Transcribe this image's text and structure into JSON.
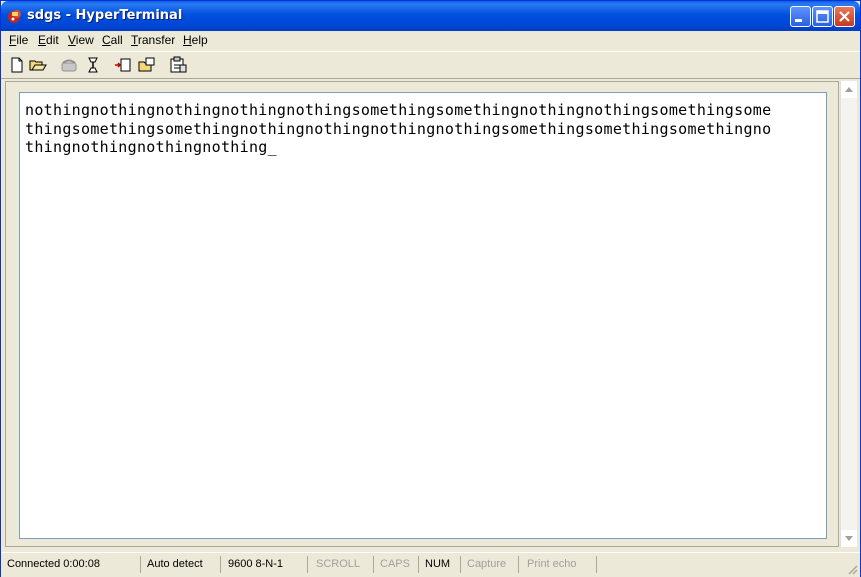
{
  "window": {
    "title": "sdgs - HyperTerminal"
  },
  "menu": [
    "File",
    "Edit",
    "View",
    "Call",
    "Transfer",
    "Help"
  ],
  "menu_underline": [
    "F",
    "E",
    "V",
    "C",
    "T",
    "H"
  ],
  "terminal": {
    "lines": [
      "nothingnothingnothingnothingnothingsomethingsomethingnothingnothingsomethingsome",
      "thingsomethingsomethingnothingnothingnothingnothingsomethingsomethingsomethingno",
      "thingnothingnothingnothing_"
    ]
  },
  "status": {
    "connected": "Connected 0:00:08",
    "detect": "Auto detect",
    "settings": "9600 8-N-1",
    "scroll": "SCROLL",
    "caps": "CAPS",
    "num": "NUM",
    "capture": "Capture",
    "print_echo": "Print echo"
  },
  "icons": {
    "toolbar": [
      "new-icon",
      "open-icon",
      "disconnect-phone-icon",
      "connect-phone-icon",
      "send-icon",
      "receive-icon",
      "properties-icon"
    ]
  },
  "colors": {
    "titlebar": "#0050e0",
    "close": "#c5391d",
    "chrome": "#ece9d8"
  }
}
